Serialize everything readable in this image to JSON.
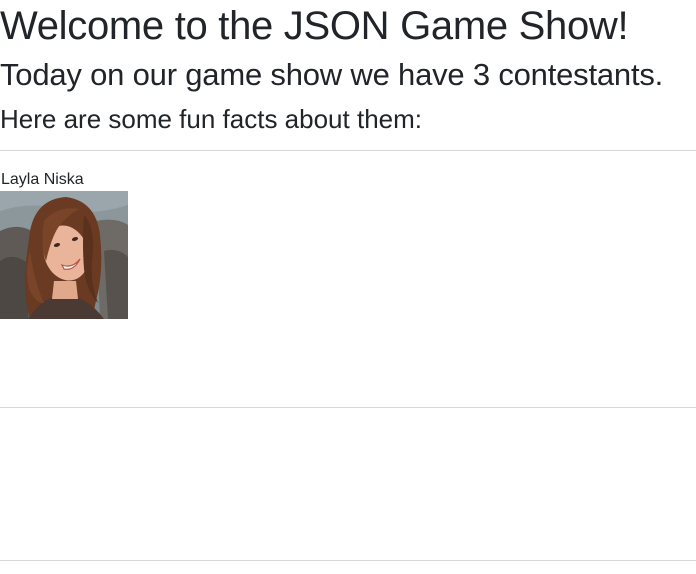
{
  "header": {
    "title": "Welcome to the JSON Game Show!",
    "subtitle": "Today on our game show we have 3 contestants.",
    "intro": "Here are some fun facts about them:"
  },
  "contestants": [
    {
      "name": "Layla Niska",
      "photo_icon": "person-photo"
    }
  ],
  "colors": {
    "text": "#212529",
    "divider": "#d6d6d6",
    "background": "#ffffff"
  }
}
